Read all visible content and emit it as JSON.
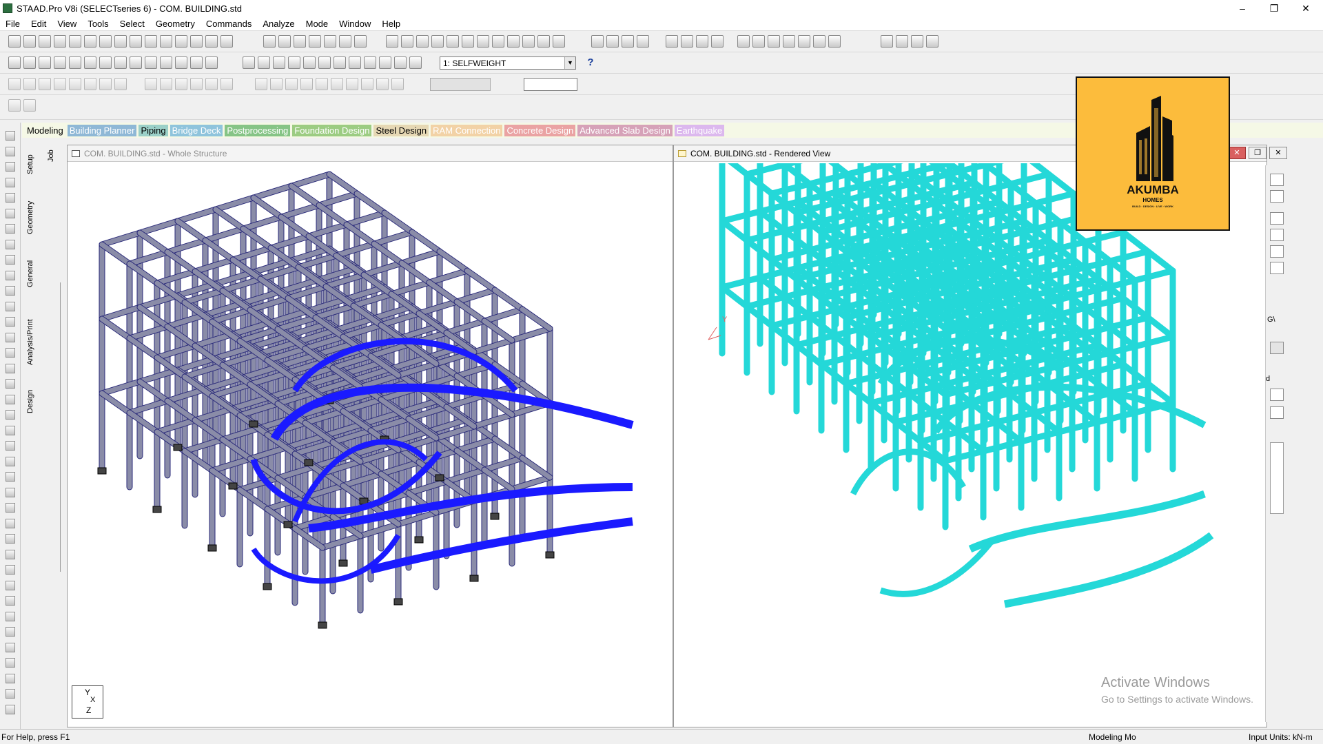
{
  "app": {
    "title": "STAAD.Pro V8i (SELECTseries 6) - COM. BUILDING.std"
  },
  "window_controls": {
    "minimize": "–",
    "maximize": "❐",
    "close": "✕"
  },
  "menu": [
    "File",
    "Edit",
    "View",
    "Tools",
    "Select",
    "Geometry",
    "Commands",
    "Analyze",
    "Mode",
    "Window",
    "Help"
  ],
  "toolbar": {
    "load_case": "1: SELFWEIGHT",
    "help_icon": "?"
  },
  "tabs": [
    {
      "label": "Modeling",
      "bg": "#f5f8e6",
      "color": "#000000"
    },
    {
      "label": "Building Planner",
      "bg": "#8fb8d6",
      "color": "#ffffff"
    },
    {
      "label": "Piping",
      "bg": "#9bd0c8",
      "color": "#000000"
    },
    {
      "label": "Bridge Deck",
      "bg": "#8fc4dc",
      "color": "#ffffff"
    },
    {
      "label": "Postprocessing",
      "bg": "#86c486",
      "color": "#ffffff"
    },
    {
      "label": "Foundation Design",
      "bg": "#9ccc82",
      "color": "#ffffff"
    },
    {
      "label": "Steel Design",
      "bg": "#e6d8b4",
      "color": "#000000"
    },
    {
      "label": "RAM Connection",
      "bg": "#f2d2a6",
      "color": "#ffffff"
    },
    {
      "label": "Concrete Design",
      "bg": "#eaa3a3",
      "color": "#ffffff"
    },
    {
      "label": "Advanced Slab Design",
      "bg": "#d6a2b8",
      "color": "#ffffff"
    },
    {
      "label": "Earthquake",
      "bg": "#dcb8ee",
      "color": "#ffffff"
    }
  ],
  "side_tabs": {
    "setup": "Setup",
    "job": "Job",
    "geometry": "Geometry",
    "general": "General",
    "analysis": "Analysis/Print",
    "design": "Design"
  },
  "windows": {
    "whole": {
      "title": "COM. BUILDING.std - Whole Structure"
    },
    "rendered": {
      "title": "COM. BUILDING.std - Rendered View",
      "axis_label": "Y"
    }
  },
  "axis_triad": {
    "y": "Y",
    "x": "X",
    "z": "Z"
  },
  "right_panel": {
    "partial_text_1": "G\\",
    "partial_text_2": "d"
  },
  "logo": {
    "name": "AKUMBA",
    "sub": "HOMES",
    "tagline": "BUILD · DESIGN · LIVE · WORK"
  },
  "watermark": {
    "line1": "Activate Windows",
    "line2": "Go to Settings to activate Windows."
  },
  "status": {
    "left": "For Help, press F1",
    "mode": "Modeling Mo",
    "units": "Input Units:   kN-m"
  },
  "colors": {
    "frame_gray": "#8a8ca8",
    "frame_blue": "#1a1aff",
    "rendered": "#24d8d8"
  }
}
